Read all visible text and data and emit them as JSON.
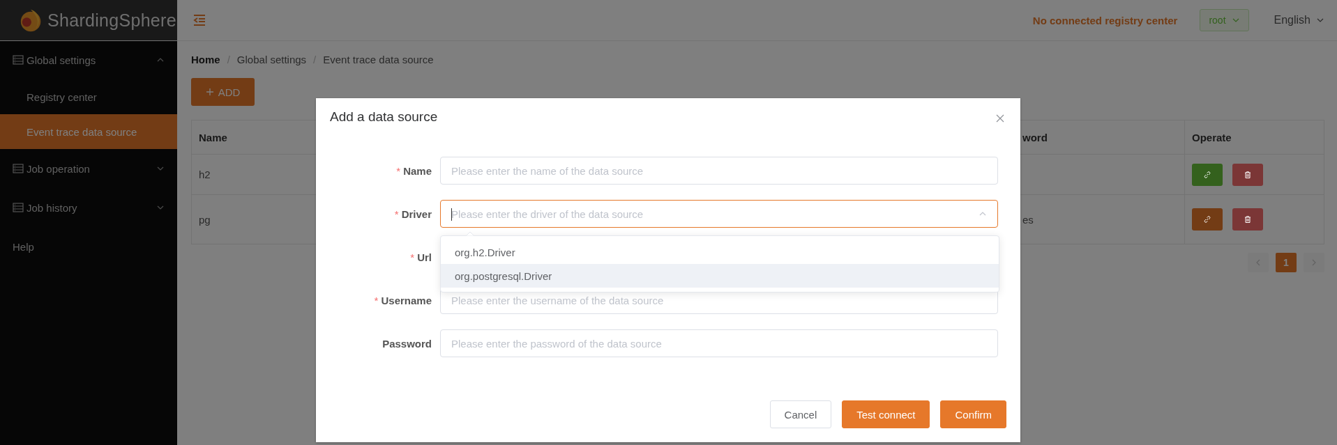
{
  "brand": {
    "name": "ShardingSphere"
  },
  "sidebar": {
    "items": [
      {
        "kind": "group",
        "label": "Global settings",
        "expanded": true,
        "children": [
          {
            "label": "Registry center",
            "selected": false
          },
          {
            "label": "Event trace data source",
            "selected": true
          }
        ]
      },
      {
        "kind": "group",
        "label": "Job operation",
        "expanded": false
      },
      {
        "kind": "group",
        "label": "Job history",
        "expanded": false
      },
      {
        "kind": "link",
        "label": "Help"
      }
    ]
  },
  "header": {
    "status": "No connected registry center",
    "user": "root",
    "language": "English"
  },
  "breadcrumb": [
    {
      "label": "Home",
      "link": true
    },
    {
      "separator": "/",
      "label": "Global settings",
      "link": false
    },
    {
      "separator": "/",
      "label": "Event trace data source",
      "link": false
    }
  ],
  "add_button": "ADD",
  "table": {
    "columns": [
      "Name",
      "word",
      "Operate"
    ],
    "rows": [
      {
        "name": "h2",
        "color": "#34611d"
      },
      {
        "name": "pg",
        "column_2": "es",
        "color": "#733c15"
      }
    ]
  },
  "pagination": {
    "prev_disabled": true,
    "next_disabled": true,
    "pages": [
      {
        "label": "1",
        "selected": true
      }
    ]
  },
  "dialog": {
    "title": "Add a data source",
    "fields": [
      {
        "kind": "input",
        "label": "Name",
        "required_mark": "*",
        "placeholder": "Please enter the name of the data source",
        "focused": false
      },
      {
        "kind": "select",
        "label": "Driver",
        "required_mark": "*",
        "placeholder": "Please enter the driver of the data source",
        "focused": true
      },
      {
        "kind": "covered",
        "label": "Url",
        "required_mark": "*"
      },
      {
        "kind": "input",
        "label": "Username",
        "required_mark": "*",
        "placeholder": "Please enter the username of the data source",
        "focused": false
      },
      {
        "kind": "input",
        "label": "Password",
        "placeholder": "Please enter the password of the data source",
        "focused": false
      }
    ],
    "driver_options": [
      {
        "label": "org.h2.Driver",
        "highlighted": false
      },
      {
        "label": "org.postgresql.Driver",
        "highlighted": true
      }
    ],
    "buttons": [
      {
        "kind": "plain",
        "label": "Cancel"
      },
      {
        "kind": "primary",
        "label": "Test connect"
      },
      {
        "kind": "primary",
        "label": "Confirm"
      }
    ]
  }
}
